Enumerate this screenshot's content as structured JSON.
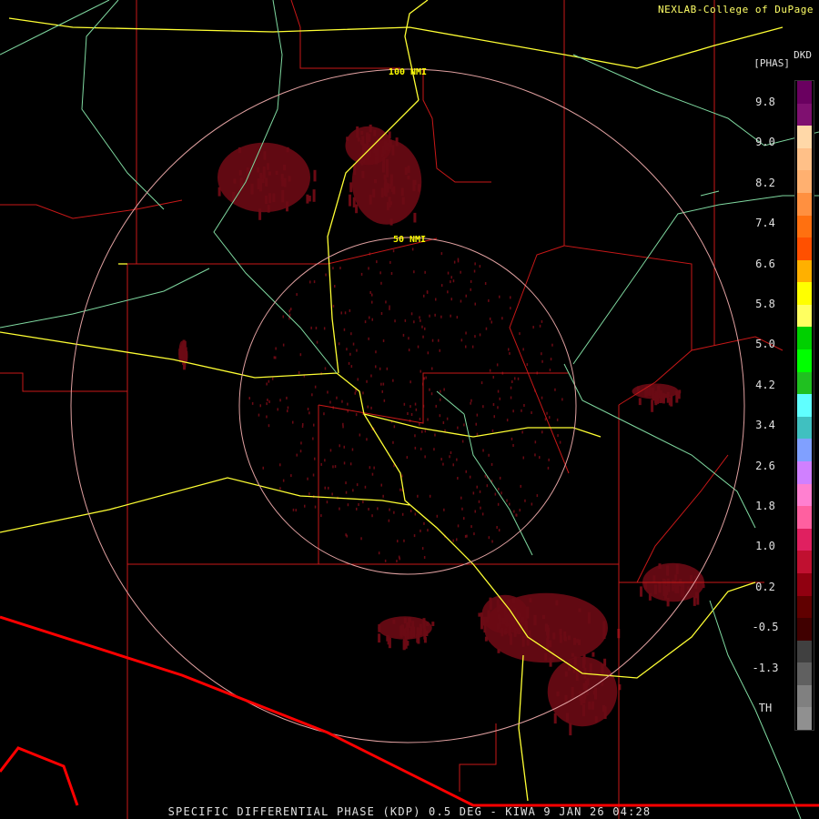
{
  "header": {
    "credit": "NEXLAB-College of DuPage",
    "unit_line1": "DKD",
    "unit_line2": "[PHAS]"
  },
  "footer": {
    "title": "SPECIFIC DIFFERENTIAL PHASE (KDP) 0.5 DEG - KIWA 9 JAN 26 04:28"
  },
  "range_rings": [
    {
      "label": "100 NMI"
    },
    {
      "label": "50 NMI"
    }
  ],
  "legend": {
    "ticks": [
      "9.8",
      "9.0",
      "8.2",
      "7.4",
      "6.6",
      "5.8",
      "5.0",
      "4.2",
      "3.4",
      "2.6",
      "1.8",
      "1.0",
      "0.2",
      "-0.5",
      "-1.3",
      "TH"
    ],
    "colors": [
      "#6a0060",
      "#7f1070",
      "#ffd8a8",
      "#ffc088",
      "#ffb070",
      "#ff9040",
      "#ff7010",
      "#ff5000",
      "#ffb000",
      "#ffff00",
      "#ffff60",
      "#00d000",
      "#00ff00",
      "#20c020",
      "#60ffff",
      "#40c0c0",
      "#80a0ff",
      "#d080ff",
      "#ff80d0",
      "#ff60a0",
      "#e02060",
      "#c01030",
      "#900010",
      "#600000",
      "#400000",
      "#404040",
      "#606060",
      "#808080",
      "#909090"
    ]
  },
  "colors": {
    "echo": "#6b0a14",
    "county_border": "#c81818",
    "state_border": "#ff0000",
    "highway_interstate": "#ffff33",
    "highway_other": "#7fd9a0",
    "range_ring": "#e0a0a0"
  }
}
